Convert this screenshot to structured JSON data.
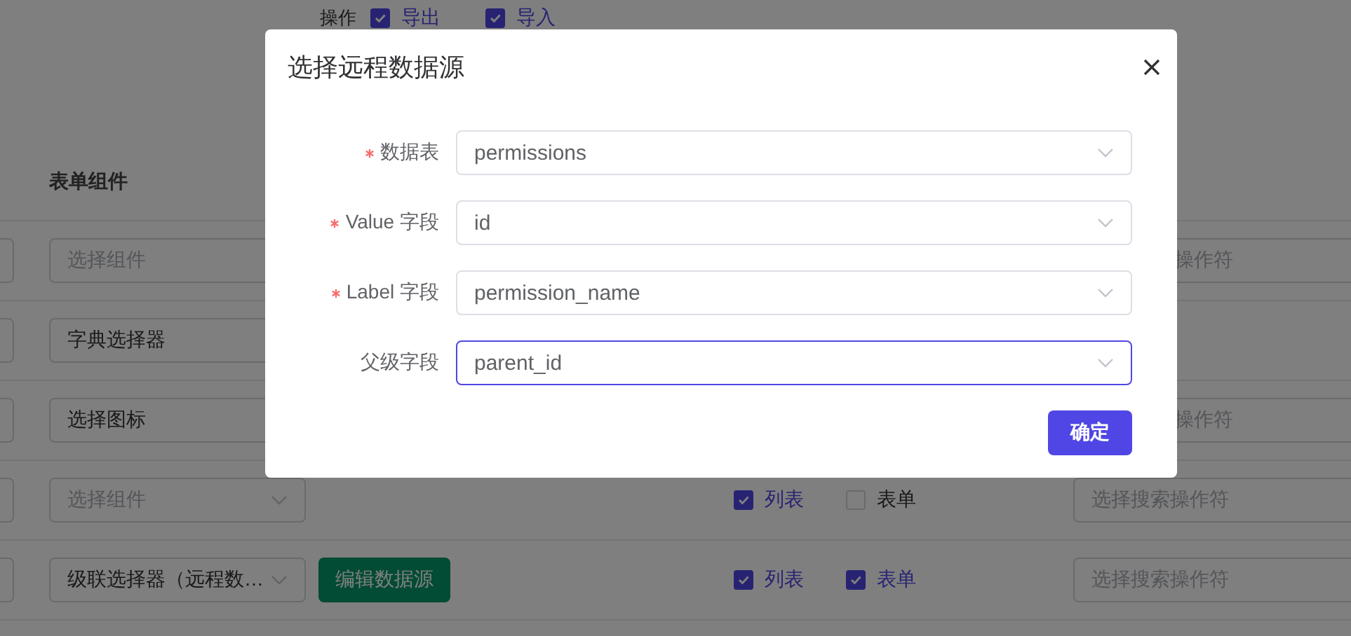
{
  "background": {
    "toolbar": {
      "label": "操作",
      "options": [
        {
          "label": "导出",
          "checked": true
        },
        {
          "label": "导入",
          "checked": true
        }
      ]
    },
    "column_header": "表单组件",
    "rows": [
      {
        "component": {
          "placeholder": "选择组件"
        },
        "search": {
          "placeholder": "操作符"
        }
      },
      {
        "component": {
          "value": "字典选择器"
        }
      },
      {
        "component": {
          "value": "选择图标"
        },
        "search": {
          "placeholder": "操作符"
        }
      },
      {
        "component": {
          "placeholder": "选择组件"
        },
        "checks": [
          {
            "label": "列表",
            "checked": true
          },
          {
            "label": "表单",
            "checked": false
          }
        ],
        "search": {
          "placeholder": "选择搜索操作符"
        }
      },
      {
        "component": {
          "value": "级联选择器（远程数…"
        },
        "button": "编辑数据源",
        "checks": [
          {
            "label": "列表",
            "checked": true
          },
          {
            "label": "表单",
            "checked": true
          }
        ],
        "search": {
          "placeholder": "选择搜索操作符"
        }
      }
    ]
  },
  "dialog": {
    "title": "选择远程数据源",
    "fields": [
      {
        "label": "数据表",
        "required": true,
        "value": "permissions",
        "focused": false
      },
      {
        "label": "Value 字段",
        "required": true,
        "value": "id",
        "focused": false
      },
      {
        "label": "Label 字段",
        "required": true,
        "value": "permission_name",
        "focused": false
      },
      {
        "label": "父级字段",
        "required": false,
        "value": "parent_id",
        "focused": true
      }
    ],
    "confirm_button": "确定"
  }
}
